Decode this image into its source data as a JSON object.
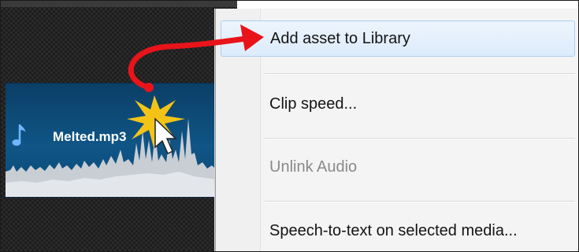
{
  "timeline": {
    "clip": {
      "label": "Melted.mp3",
      "icon": "music-note-icon"
    }
  },
  "context_menu": {
    "items": [
      {
        "label": "Add asset to Library",
        "state": "highlighted"
      },
      {
        "label": "Clip speed...",
        "state": "enabled"
      },
      {
        "label": "Unlink Audio",
        "state": "disabled"
      },
      {
        "label": "Speech-to-text on selected media...",
        "state": "enabled"
      }
    ]
  },
  "annotation": {
    "arrow_color": "#e8141a",
    "burst_color": "#f3c417"
  },
  "colors": {
    "clip_blue": "#0f5586",
    "menu_highlight": "#dcebfb"
  }
}
